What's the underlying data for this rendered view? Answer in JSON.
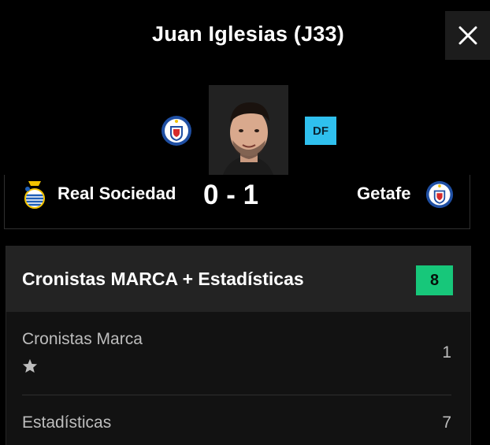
{
  "header": {
    "title": "Juan Iglesias (J33)"
  },
  "player": {
    "position": "DF"
  },
  "match": {
    "home_team": "Real Sociedad",
    "score": "0 - 1",
    "away_team": "Getafe"
  },
  "rating_card": {
    "title": "Cronistas MARCA + Estadísticas",
    "total": "8",
    "rows": [
      {
        "label": "Cronistas Marca",
        "value": "1"
      },
      {
        "label": "Estadísticas",
        "value": "7"
      }
    ]
  },
  "icons": {
    "close": "close-icon",
    "star": "star-icon"
  },
  "colors": {
    "background": "#000000",
    "position_badge": "#2fc0ee",
    "score_badge": "#17c77a",
    "getafe_blue": "#1f4fa3"
  }
}
